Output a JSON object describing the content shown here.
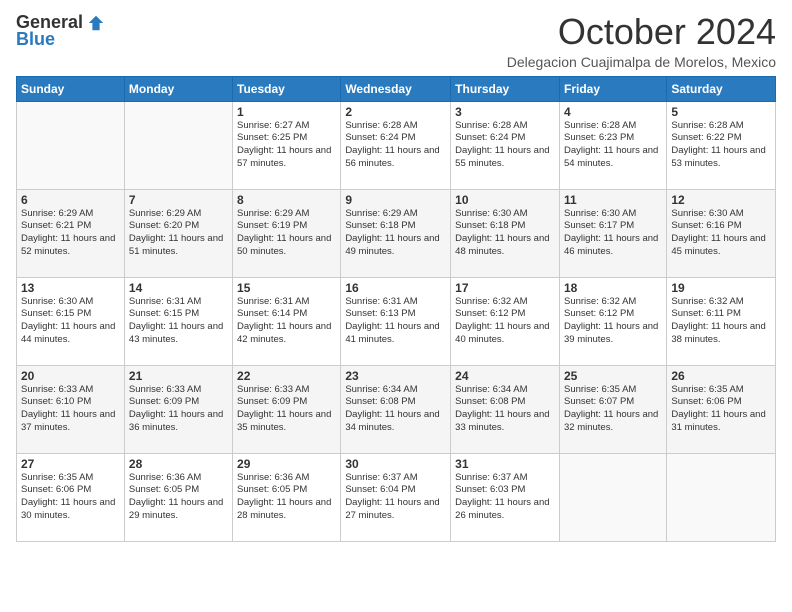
{
  "logo": {
    "general": "General",
    "blue": "Blue"
  },
  "title": "October 2024",
  "location": "Delegacion Cuajimalpa de Morelos, Mexico",
  "days_of_week": [
    "Sunday",
    "Monday",
    "Tuesday",
    "Wednesday",
    "Thursday",
    "Friday",
    "Saturday"
  ],
  "weeks": [
    [
      {
        "day": "",
        "sunrise": "",
        "sunset": "",
        "daylight": ""
      },
      {
        "day": "",
        "sunrise": "",
        "sunset": "",
        "daylight": ""
      },
      {
        "day": "1",
        "sunrise": "Sunrise: 6:27 AM",
        "sunset": "Sunset: 6:25 PM",
        "daylight": "Daylight: 11 hours and 57 minutes."
      },
      {
        "day": "2",
        "sunrise": "Sunrise: 6:28 AM",
        "sunset": "Sunset: 6:24 PM",
        "daylight": "Daylight: 11 hours and 56 minutes."
      },
      {
        "day": "3",
        "sunrise": "Sunrise: 6:28 AM",
        "sunset": "Sunset: 6:24 PM",
        "daylight": "Daylight: 11 hours and 55 minutes."
      },
      {
        "day": "4",
        "sunrise": "Sunrise: 6:28 AM",
        "sunset": "Sunset: 6:23 PM",
        "daylight": "Daylight: 11 hours and 54 minutes."
      },
      {
        "day": "5",
        "sunrise": "Sunrise: 6:28 AM",
        "sunset": "Sunset: 6:22 PM",
        "daylight": "Daylight: 11 hours and 53 minutes."
      }
    ],
    [
      {
        "day": "6",
        "sunrise": "Sunrise: 6:29 AM",
        "sunset": "Sunset: 6:21 PM",
        "daylight": "Daylight: 11 hours and 52 minutes."
      },
      {
        "day": "7",
        "sunrise": "Sunrise: 6:29 AM",
        "sunset": "Sunset: 6:20 PM",
        "daylight": "Daylight: 11 hours and 51 minutes."
      },
      {
        "day": "8",
        "sunrise": "Sunrise: 6:29 AM",
        "sunset": "Sunset: 6:19 PM",
        "daylight": "Daylight: 11 hours and 50 minutes."
      },
      {
        "day": "9",
        "sunrise": "Sunrise: 6:29 AM",
        "sunset": "Sunset: 6:18 PM",
        "daylight": "Daylight: 11 hours and 49 minutes."
      },
      {
        "day": "10",
        "sunrise": "Sunrise: 6:30 AM",
        "sunset": "Sunset: 6:18 PM",
        "daylight": "Daylight: 11 hours and 48 minutes."
      },
      {
        "day": "11",
        "sunrise": "Sunrise: 6:30 AM",
        "sunset": "Sunset: 6:17 PM",
        "daylight": "Daylight: 11 hours and 46 minutes."
      },
      {
        "day": "12",
        "sunrise": "Sunrise: 6:30 AM",
        "sunset": "Sunset: 6:16 PM",
        "daylight": "Daylight: 11 hours and 45 minutes."
      }
    ],
    [
      {
        "day": "13",
        "sunrise": "Sunrise: 6:30 AM",
        "sunset": "Sunset: 6:15 PM",
        "daylight": "Daylight: 11 hours and 44 minutes."
      },
      {
        "day": "14",
        "sunrise": "Sunrise: 6:31 AM",
        "sunset": "Sunset: 6:15 PM",
        "daylight": "Daylight: 11 hours and 43 minutes."
      },
      {
        "day": "15",
        "sunrise": "Sunrise: 6:31 AM",
        "sunset": "Sunset: 6:14 PM",
        "daylight": "Daylight: 11 hours and 42 minutes."
      },
      {
        "day": "16",
        "sunrise": "Sunrise: 6:31 AM",
        "sunset": "Sunset: 6:13 PM",
        "daylight": "Daylight: 11 hours and 41 minutes."
      },
      {
        "day": "17",
        "sunrise": "Sunrise: 6:32 AM",
        "sunset": "Sunset: 6:12 PM",
        "daylight": "Daylight: 11 hours and 40 minutes."
      },
      {
        "day": "18",
        "sunrise": "Sunrise: 6:32 AM",
        "sunset": "Sunset: 6:12 PM",
        "daylight": "Daylight: 11 hours and 39 minutes."
      },
      {
        "day": "19",
        "sunrise": "Sunrise: 6:32 AM",
        "sunset": "Sunset: 6:11 PM",
        "daylight": "Daylight: 11 hours and 38 minutes."
      }
    ],
    [
      {
        "day": "20",
        "sunrise": "Sunrise: 6:33 AM",
        "sunset": "Sunset: 6:10 PM",
        "daylight": "Daylight: 11 hours and 37 minutes."
      },
      {
        "day": "21",
        "sunrise": "Sunrise: 6:33 AM",
        "sunset": "Sunset: 6:09 PM",
        "daylight": "Daylight: 11 hours and 36 minutes."
      },
      {
        "day": "22",
        "sunrise": "Sunrise: 6:33 AM",
        "sunset": "Sunset: 6:09 PM",
        "daylight": "Daylight: 11 hours and 35 minutes."
      },
      {
        "day": "23",
        "sunrise": "Sunrise: 6:34 AM",
        "sunset": "Sunset: 6:08 PM",
        "daylight": "Daylight: 11 hours and 34 minutes."
      },
      {
        "day": "24",
        "sunrise": "Sunrise: 6:34 AM",
        "sunset": "Sunset: 6:08 PM",
        "daylight": "Daylight: 11 hours and 33 minutes."
      },
      {
        "day": "25",
        "sunrise": "Sunrise: 6:35 AM",
        "sunset": "Sunset: 6:07 PM",
        "daylight": "Daylight: 11 hours and 32 minutes."
      },
      {
        "day": "26",
        "sunrise": "Sunrise: 6:35 AM",
        "sunset": "Sunset: 6:06 PM",
        "daylight": "Daylight: 11 hours and 31 minutes."
      }
    ],
    [
      {
        "day": "27",
        "sunrise": "Sunrise: 6:35 AM",
        "sunset": "Sunset: 6:06 PM",
        "daylight": "Daylight: 11 hours and 30 minutes."
      },
      {
        "day": "28",
        "sunrise": "Sunrise: 6:36 AM",
        "sunset": "Sunset: 6:05 PM",
        "daylight": "Daylight: 11 hours and 29 minutes."
      },
      {
        "day": "29",
        "sunrise": "Sunrise: 6:36 AM",
        "sunset": "Sunset: 6:05 PM",
        "daylight": "Daylight: 11 hours and 28 minutes."
      },
      {
        "day": "30",
        "sunrise": "Sunrise: 6:37 AM",
        "sunset": "Sunset: 6:04 PM",
        "daylight": "Daylight: 11 hours and 27 minutes."
      },
      {
        "day": "31",
        "sunrise": "Sunrise: 6:37 AM",
        "sunset": "Sunset: 6:03 PM",
        "daylight": "Daylight: 11 hours and 26 minutes."
      },
      {
        "day": "",
        "sunrise": "",
        "sunset": "",
        "daylight": ""
      },
      {
        "day": "",
        "sunrise": "",
        "sunset": "",
        "daylight": ""
      }
    ]
  ]
}
